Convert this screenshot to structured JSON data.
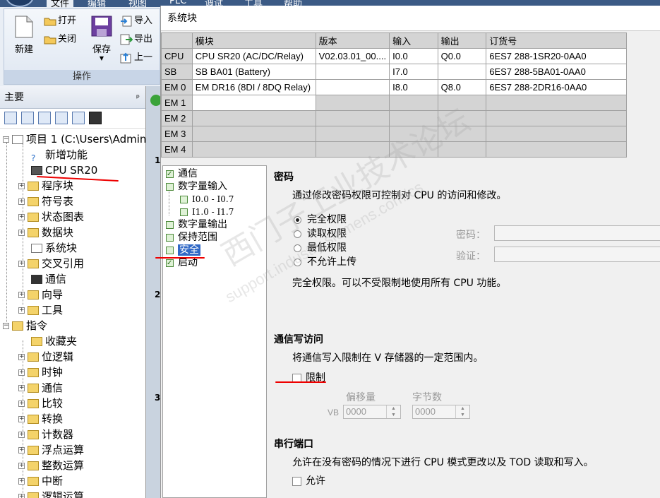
{
  "ribbon": {
    "tabs": [
      "文件",
      "编辑",
      "视图",
      "PLC",
      "调试",
      "工具",
      "帮助"
    ],
    "group_label": "操作",
    "new_label": "新建",
    "open_label": "打开",
    "close_label": "关闭",
    "save_label": "保存",
    "import_label": "导入",
    "export_label": "导出",
    "upload_label": "上一"
  },
  "nav": {
    "title": "主要",
    "pin": "ᵖ",
    "project": "项目 1 (C:\\Users\\Admin",
    "items": [
      "新增功能",
      "CPU SR20",
      "程序块",
      "符号表",
      "状态图表",
      "数据块",
      "系统块",
      "交叉引用",
      "通信",
      "向导",
      "工具"
    ],
    "instructions": "指令",
    "instr_items": [
      "收藏夹",
      "位逻辑",
      "时钟",
      "通信",
      "比较",
      "转换",
      "计数器",
      "浮点运算",
      "整数运算",
      "中断",
      "逻辑运算"
    ]
  },
  "strip": {
    "nums": [
      "1",
      "2",
      "3"
    ]
  },
  "dialog": {
    "title": "系统块",
    "table": {
      "headers": [
        "",
        "模块",
        "版本",
        "输入",
        "输出",
        "订货号"
      ],
      "rows": [
        [
          "CPU",
          "CPU SR20 (AC/DC/Relay)",
          "V02.03.01_00....",
          "I0.0",
          "Q0.0",
          "6ES7 288-1SR20-0AA0"
        ],
        [
          "SB",
          "SB BA01 (Battery)",
          "",
          "I7.0",
          "",
          "6ES7 288-5BA01-0AA0"
        ],
        [
          "EM 0",
          "EM DR16 (8DI / 8DQ Relay)",
          "",
          "I8.0",
          "Q8.0",
          "6ES7 288-2DR16-0AA0"
        ],
        [
          "EM 1",
          "",
          "",
          "",
          "",
          ""
        ],
        [
          "EM 2",
          "",
          "",
          "",
          "",
          ""
        ],
        [
          "EM 3",
          "",
          "",
          "",
          "",
          ""
        ],
        [
          "EM 4",
          "",
          "",
          "",
          "",
          ""
        ]
      ]
    },
    "tree": {
      "comm": "通信",
      "di": "数字量输入",
      "di_a": "I0.0 - I0.7",
      "di_b": "I1.0 - I1.7",
      "do": "数字量输出",
      "retain": "保持范围",
      "security": "安全",
      "startup": "启动"
    },
    "password": {
      "title": "密码",
      "desc": "通过修改密码权限可控制对 CPU 的访问和修改。",
      "options": [
        "完全权限",
        "读取权限",
        "最低权限",
        "不允许上传"
      ],
      "selected": "完全权限",
      "pw_label": "密码：",
      "verify_label": "验证：",
      "info": "完全权限。可以不受限制地使用所有 CPU 功能。"
    },
    "comm_write": {
      "title": "通信写访问",
      "desc": "将通信写入限制在 V 存储器的一定范围内。",
      "restrict_label": "限制",
      "offset_label": "偏移量",
      "bytes_label": "字节数",
      "vb_label": "VB",
      "offset_value": "0000",
      "bytes_value": "0000"
    },
    "serial": {
      "title": "串行端口",
      "desc": "允许在没有密码的情况下进行 CPU 模式更改以及 TOD 读取和写入。",
      "allow_label": "允许"
    },
    "watermark": "西门子工业技术论坛",
    "watermark_url": "support.industry.siemens.com/cs"
  }
}
